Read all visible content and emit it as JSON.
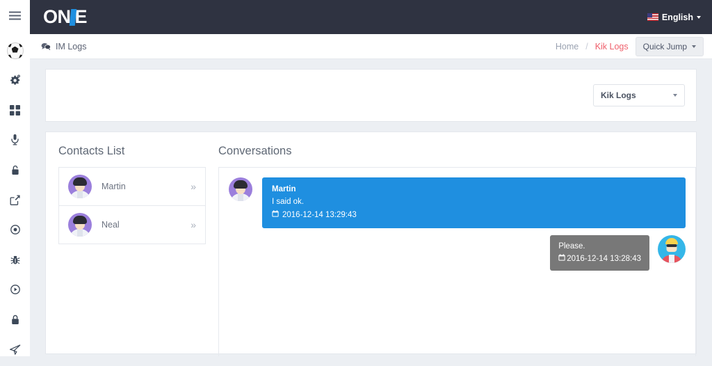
{
  "brand": {
    "text_left": "ON",
    "text_right": "E"
  },
  "topbar": {
    "language_label": "English",
    "flag_icon": "us-flag-icon",
    "menu_icon": "hamburger-icon"
  },
  "sidebar": {
    "items": [
      {
        "icon": "soccer-ball-icon",
        "name": "sidebar-item-soccer"
      },
      {
        "icon": "cogs-icon",
        "name": "sidebar-item-settings"
      },
      {
        "icon": "grid-icon",
        "name": "sidebar-item-apps"
      },
      {
        "icon": "microphone-icon",
        "name": "sidebar-item-microphone"
      },
      {
        "icon": "unlock-icon",
        "name": "sidebar-item-unlock"
      },
      {
        "icon": "edit-square-icon",
        "name": "sidebar-item-edit"
      },
      {
        "icon": "record-circle-icon",
        "name": "sidebar-item-record"
      },
      {
        "icon": "bug-icon",
        "name": "sidebar-item-bug"
      },
      {
        "icon": "play-circle-icon",
        "name": "sidebar-item-play"
      },
      {
        "icon": "lock-icon",
        "name": "sidebar-item-lock"
      },
      {
        "icon": "paper-plane-icon",
        "name": "sidebar-item-send"
      }
    ]
  },
  "page": {
    "title": "IM Logs",
    "title_icon": "comments-icon",
    "breadcrumb": {
      "home": "Home",
      "separator": "/",
      "current": "Kik Logs"
    },
    "quick_jump_label": "Quick Jump"
  },
  "filter": {
    "selected": "Kik Logs",
    "caret_icon": "chevron-down-icon"
  },
  "contacts": {
    "title": "Contacts List",
    "items": [
      {
        "name": "Martin",
        "chevron": "»",
        "avatar": "purple-avatar"
      },
      {
        "name": "Neal",
        "chevron": "»",
        "avatar": "purple-avatar"
      }
    ]
  },
  "conversations": {
    "title": "Conversations",
    "messages": [
      {
        "side": "left",
        "sender": "Martin",
        "text": "I said ok.",
        "time": "2016-12-14 13:29:43",
        "avatar": "purple-avatar",
        "color": "#1f8fe0"
      },
      {
        "side": "right",
        "sender": "",
        "text": "Please.",
        "time": "2016-12-14 13:28:43",
        "avatar": "blue-avatar",
        "color": "#787878"
      }
    ]
  },
  "colors": {
    "header_bg": "#2f3341",
    "page_bg": "#eceff3",
    "accent_blue": "#1f8fe0",
    "accent_red": "#ef5f6b",
    "bubble_gray": "#787878"
  }
}
